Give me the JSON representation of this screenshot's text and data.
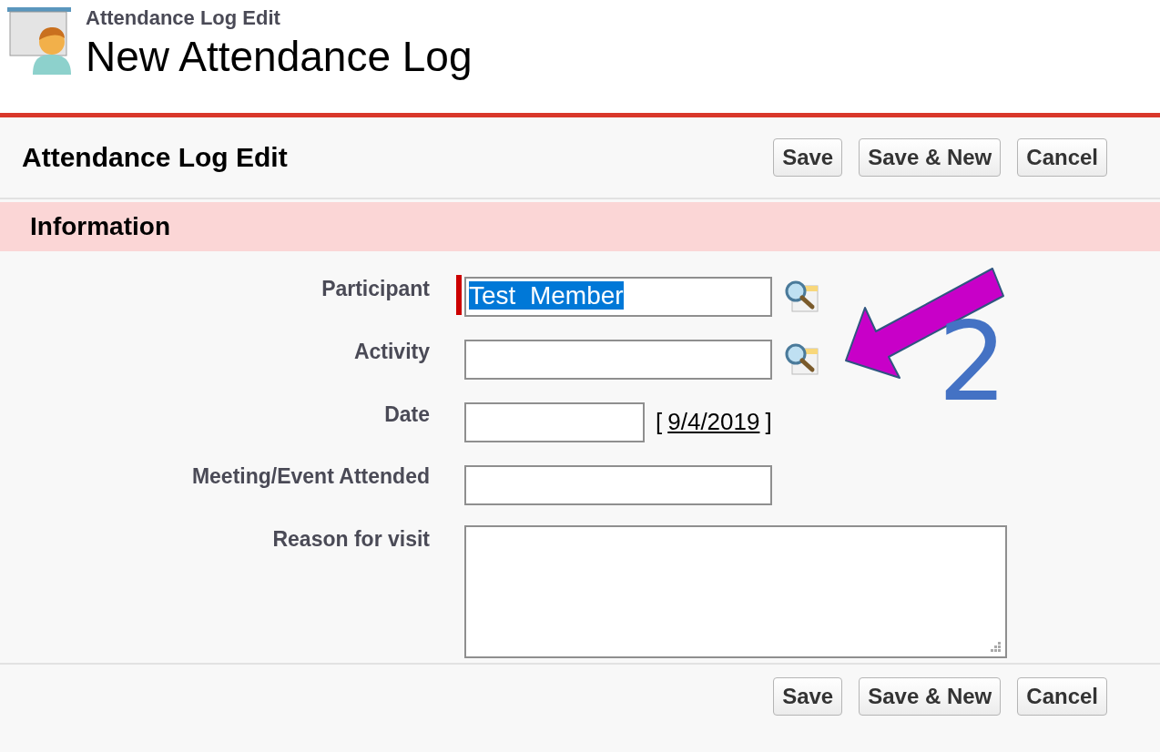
{
  "header": {
    "breadcrumb": "Attendance Log Edit",
    "title": "New Attendance Log"
  },
  "panel": {
    "title": "Attendance Log Edit",
    "top_buttons": [
      "Save",
      "Save & New",
      "Cancel"
    ],
    "section": {
      "title": "Information"
    },
    "fields": [
      {
        "kind": "lookup",
        "label": "Participant",
        "value": "Test  Member",
        "required": true,
        "text_selected": true
      },
      {
        "kind": "lookup",
        "label": "Activity",
        "required": false
      },
      {
        "kind": "date",
        "label": "Date",
        "required": false,
        "bracket_open": "[",
        "today_link": "9/4/2019",
        "bracket_close": "]"
      },
      {
        "kind": "text",
        "label": "Meeting/Event Attended",
        "required": false
      },
      {
        "kind": "textarea",
        "label": "Reason for visit",
        "required": false
      }
    ],
    "bottom_buttons": [
      "Save",
      "Save & New",
      "Cancel"
    ]
  },
  "annotation": {
    "number": "2"
  }
}
